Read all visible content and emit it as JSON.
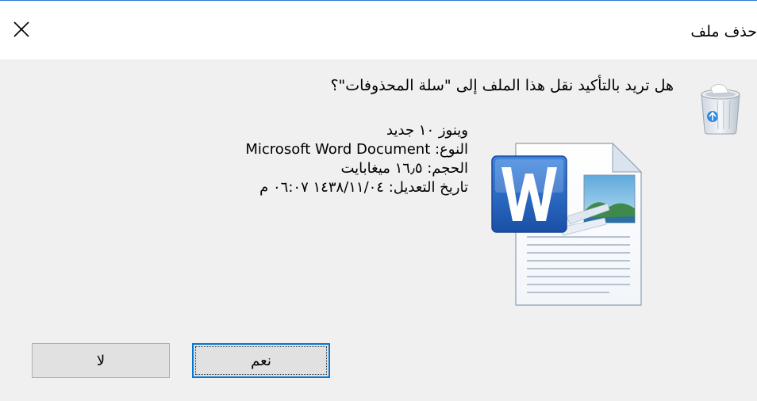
{
  "dialog": {
    "title": "حذف ملف",
    "question": "هل تريد بالتأكيد نقل هذا الملف إلى \"سلة المحذوفات\"؟"
  },
  "file": {
    "name": "وينوز ١٠ جديد",
    "type_label": "النوع: ",
    "type_value": "Microsoft Word Document",
    "size": "الحجم: ١٦٫٥ ميغابايت",
    "modified": "تاريخ التعديل: ١٤٣٨/١١/٠٤ ٠٦:٠٧ م"
  },
  "buttons": {
    "yes_label": "نعم",
    "no_label": "لا"
  },
  "icons": {
    "close": "close-icon",
    "recycle_bin": "recycle-bin-icon",
    "document": "word-document-icon"
  },
  "colors": {
    "window_border": "#2b7bd3",
    "dialog_bg": "#f0f0f0",
    "button_bg": "#e1e1e1",
    "default_button_border": "#0078d7",
    "word_blue": "#1e5fb8"
  }
}
